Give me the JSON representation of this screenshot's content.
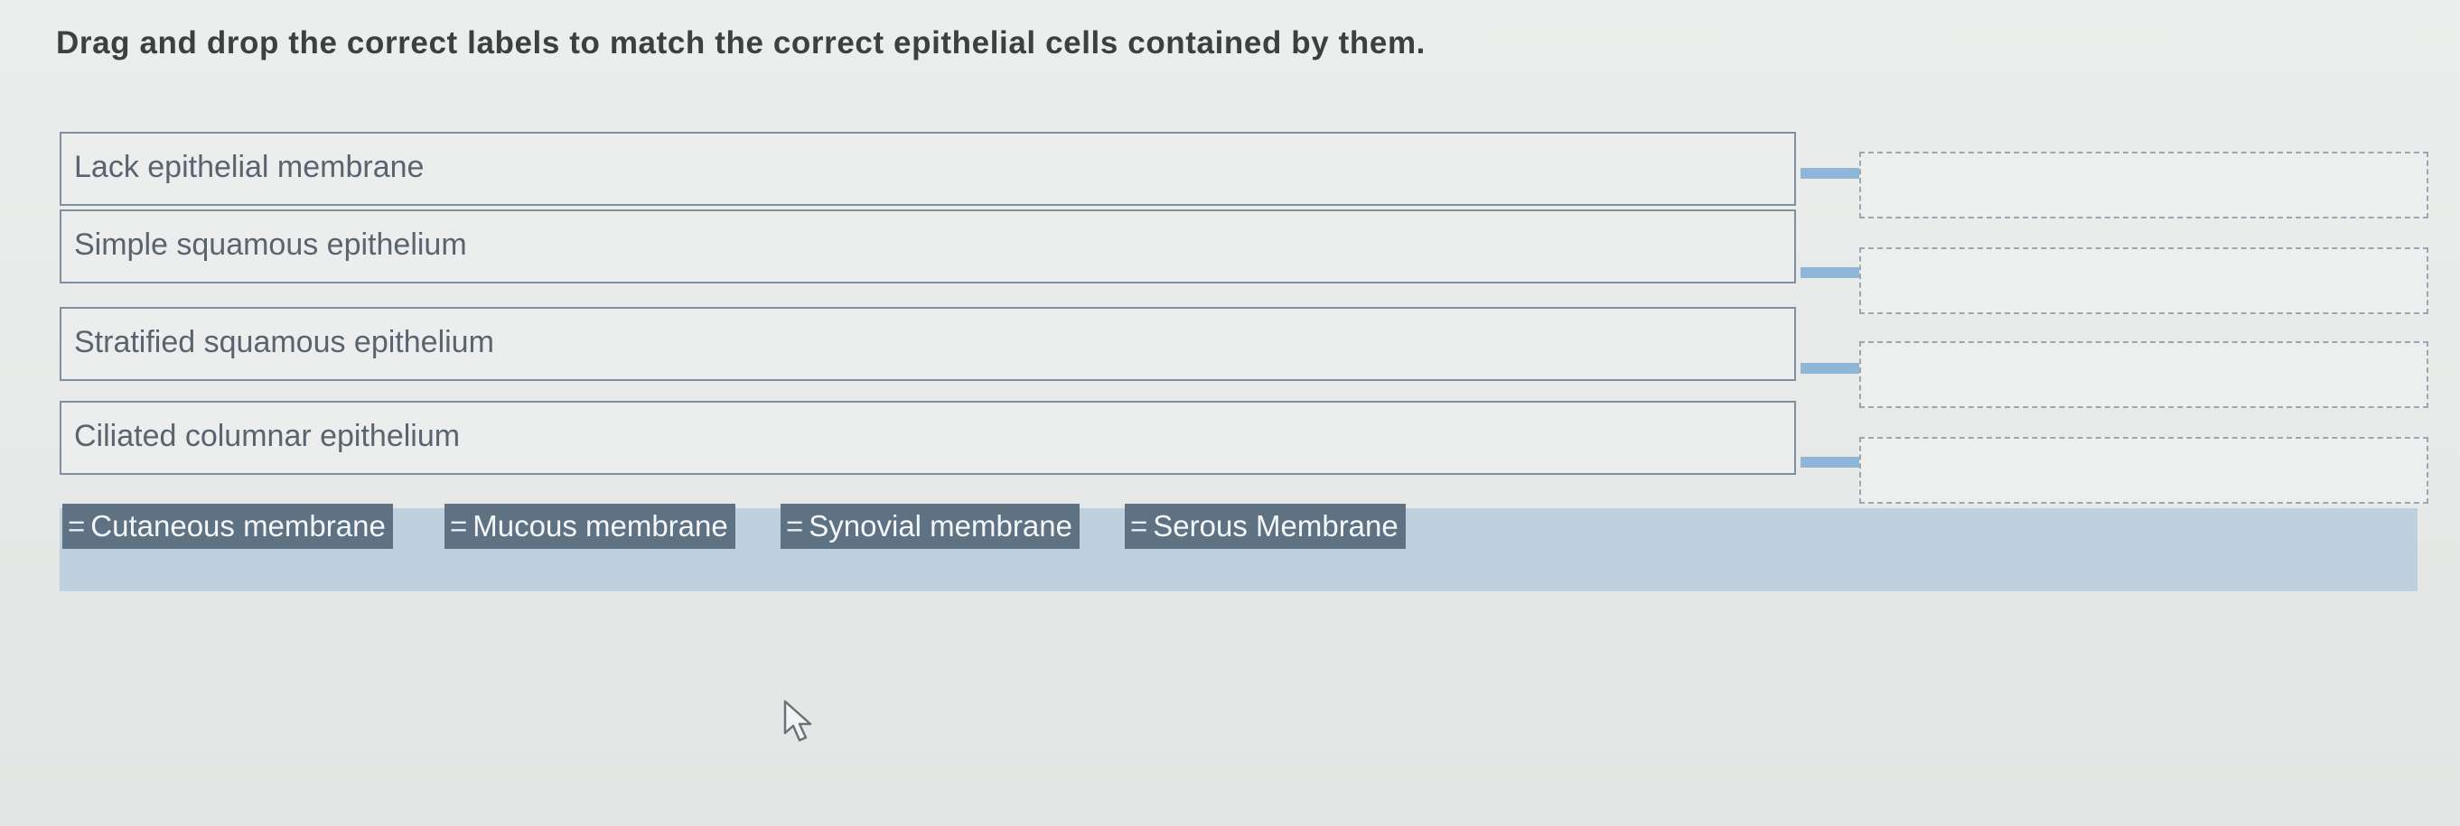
{
  "instruction": "Drag and drop the correct labels to match the correct epithelial cells contained by them.",
  "rows": [
    {
      "label": "Lack epithelial membrane"
    },
    {
      "label": "Simple squamous epithelium"
    },
    {
      "label": "Stratified squamous epithelium"
    },
    {
      "label": "Ciliated columnar epithelium"
    }
  ],
  "labels": [
    {
      "text": "Cutaneous membrane",
      "grip": "="
    },
    {
      "text": "Mucous membrane",
      "grip": "="
    },
    {
      "text": "Synovial membrane",
      "grip": "="
    },
    {
      "text": "Serous Membrane",
      "grip": "="
    }
  ],
  "colors": {
    "chip": "#5f7283",
    "tray": "#bfd1de",
    "connector": "#8fb6d6"
  },
  "icons": {
    "grip": "drag-handle-icon",
    "cursor": "mouse-pointer-icon"
  }
}
